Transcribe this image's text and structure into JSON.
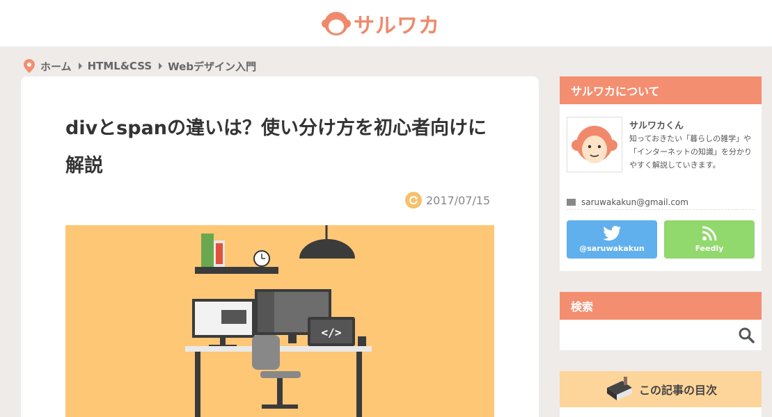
{
  "header": {
    "logo_text": "サルワカ"
  },
  "breadcrumb": {
    "items": [
      "ホーム",
      "HTML&CSS",
      "Webデザイン入門"
    ]
  },
  "article": {
    "title": "divとspanの違いは？使い分け方を初心者向けに解説",
    "date": "2017/07/15"
  },
  "sidebar": {
    "about": {
      "heading": "サルワカについて",
      "name": "サルワカくん",
      "description": "知っておきたい「暮らしの雑学」や「インターネットの知識」を分かりやすく解説していきます。",
      "email": "saruwakakun@gmail.com",
      "twitter_label": "@saruwakakun",
      "feedly_label": "Feedly"
    },
    "search": {
      "heading": "検索",
      "placeholder": ""
    },
    "toc": {
      "heading": "この記事の目次"
    }
  },
  "colors": {
    "accent": "#f48e70",
    "twitter": "#60b0ee",
    "feedly": "#91d86d",
    "hero_bg": "#fdc776",
    "toc_bg": "#fdd59a"
  }
}
